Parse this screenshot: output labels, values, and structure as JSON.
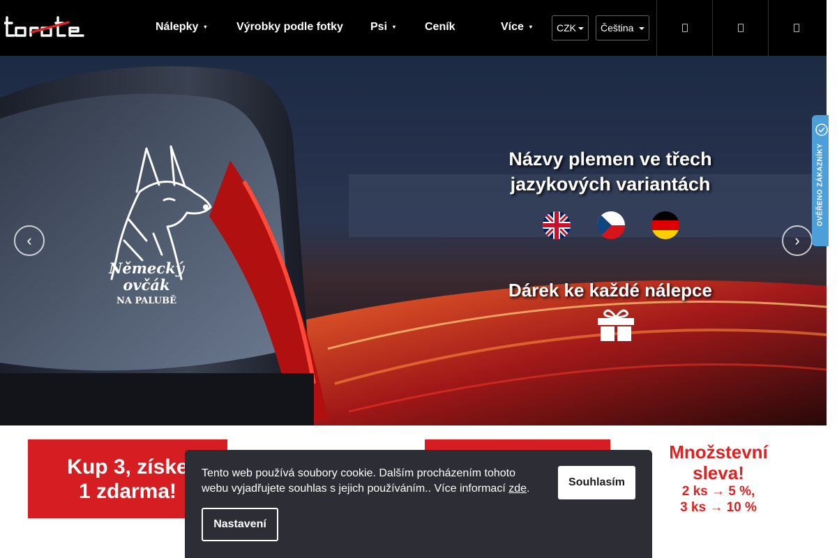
{
  "header": {
    "logo_alt": "tomte",
    "nav": [
      {
        "label": "Nálepky",
        "caret": "▾"
      },
      {
        "label": "Výrobky podle fotky"
      },
      {
        "label": "Psi",
        "caret": "▾"
      },
      {
        "label": "Ceník"
      },
      {
        "label": "Více",
        "caret": "▾"
      }
    ],
    "currency": "CZK",
    "language": "Čeština",
    "icons": [
      "search-icon",
      "user-icon",
      "cart-icon"
    ]
  },
  "hero": {
    "dog_caption_line1": "Německý ovčák",
    "dog_caption_line2": "NA PALUBĚ",
    "headline_line1": "Názvy plemen ve třech",
    "headline_line2": "jazykových variantách",
    "gift_text": "Dárek ke každé nálepce",
    "prev_arrow": "‹",
    "next_arrow": "›",
    "flags": [
      "uk-flag-icon",
      "cz-flag-icon",
      "de-flag-icon"
    ]
  },
  "trust_badge": {
    "text": "OVĚŘENO ZÁKAZNÍKY"
  },
  "promos": {
    "banner1_line1": "Kup 3, získe",
    "banner1_line2": "1 zdarma!",
    "quantity_title_line1": "Množstevní",
    "quantity_title_line2": "sleva!",
    "quantity_line1": "2 ks → 5 %,",
    "quantity_line2": "3 ks → 10 %"
  },
  "cookie": {
    "text": "Tento web používá soubory cookie. Dalším procházením tohoto webu vyjadřujete souhlas s jejich používáním.. Více informací ",
    "link_label": "zde",
    "text_end": ".",
    "accept_label": "Souhlasím",
    "settings_label": "Nastavení"
  },
  "colors": {
    "header_bg": "#000000",
    "promo_red": "#d51d22",
    "cookie_bg": "#2d2d35",
    "trust_blue": "#4d9fd9"
  }
}
